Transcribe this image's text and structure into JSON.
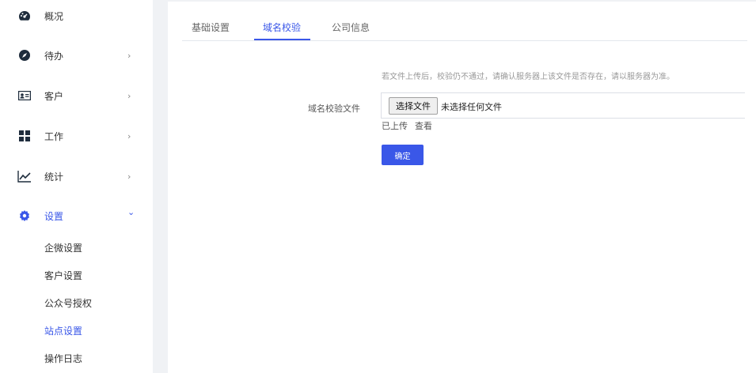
{
  "sidebar": {
    "items": [
      {
        "label": "概况",
        "icon": "dashboard-icon"
      },
      {
        "label": "待办",
        "icon": "compass-icon",
        "arrow": "›"
      },
      {
        "label": "客户",
        "icon": "contact-card-icon",
        "arrow": "›"
      },
      {
        "label": "工作",
        "icon": "grid-icon",
        "arrow": "›"
      },
      {
        "label": "统计",
        "icon": "line-chart-icon",
        "arrow": "›"
      },
      {
        "label": "设置",
        "icon": "gear-icon",
        "arrow": "⌄"
      }
    ],
    "sub_items": [
      {
        "label": "企微设置"
      },
      {
        "label": "客户设置"
      },
      {
        "label": "公众号授权"
      },
      {
        "label": "站点设置"
      },
      {
        "label": "操作日志"
      }
    ]
  },
  "tabs": [
    {
      "label": "基础设置"
    },
    {
      "label": "域名校验"
    },
    {
      "label": "公司信息"
    }
  ],
  "form": {
    "hint": "若文件上传后，校验仍不通过，请确认服务器上该文件是否存在，请以服务器为准。",
    "field_label": "域名校验文件",
    "file_button": "选择文件",
    "file_status": "未选择任何文件",
    "uploaded_text": "已上传",
    "view_link": "查看",
    "confirm_label": "确定"
  },
  "colors": {
    "accent": "#3a57e8",
    "icon": "#1f2d3d"
  }
}
